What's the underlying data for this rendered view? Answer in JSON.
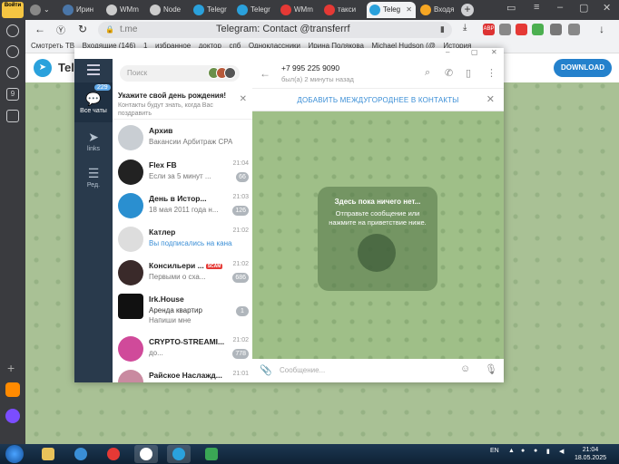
{
  "browser": {
    "profile_label": "Войти",
    "tabs": [
      {
        "label": "",
        "favicon_color": "#888888"
      },
      {
        "label": "Ирин",
        "favicon_color": "#4a76a8"
      },
      {
        "label": "WMm",
        "favicon_color": "#cccccc"
      },
      {
        "label": "Node",
        "favicon_color": "#cccccc"
      },
      {
        "label": "Telegr",
        "favicon_color": "#2aa1dc"
      },
      {
        "label": "Telegr",
        "favicon_color": "#2aa1dc"
      },
      {
        "label": "WMm",
        "favicon_color": "#e53935"
      },
      {
        "label": "такси",
        "favicon_color": "#e53935"
      },
      {
        "label": "Teleg",
        "favicon_color": "#2aa1dc",
        "active": true
      },
      {
        "label": "Входя",
        "favicon_color": "#f6a623"
      }
    ],
    "address": {
      "host": "t.me",
      "page_title": "Telegram: Contact @transferrf"
    },
    "bookmarks": [
      "Смотреть ТВ",
      "Входящие (146)",
      "1",
      "избранное",
      "доктор",
      "спб",
      "Одноклассники",
      "Ирина Полякова",
      "Michael Hudson (@",
      "История"
    ]
  },
  "tg_web": {
    "brand": "Telegram",
    "download_label": "DOWNLOAD"
  },
  "sidenav": {
    "items": [
      {
        "label": "Все чаты",
        "badge": "229",
        "icon": "chat-bubbles-icon"
      },
      {
        "label": "links",
        "icon": "send-icon"
      },
      {
        "label": "Ред.",
        "icon": "sliders-icon"
      }
    ]
  },
  "chatlist": {
    "search_placeholder": "Поиск",
    "birthday": {
      "title": "Укажите свой день рождения!",
      "subtitle": "Контакты будут знать, когда Вас поздравить"
    },
    "archive": {
      "name": "Архив",
      "preview": "Вакансии Арбитраж CPA, S..."
    },
    "chats": [
      {
        "name": "Flex FB",
        "preview": "Если за 5 минут ...",
        "time": "21:04",
        "count": "66",
        "avatar": "#222222",
        "blue": false
      },
      {
        "name": "День в Истор...",
        "preview": "18 мая 2011 года н...",
        "time": "21:03",
        "count": "126",
        "avatar": "#2a8fd0",
        "blue": false
      },
      {
        "name": "Катлер",
        "preview": "Вы подписались на канал",
        "time": "21:02",
        "count": "",
        "avatar": "#dddddd",
        "blue": true
      },
      {
        "name": "Консильери ...",
        "scam": "SCAM",
        "preview": "Первыми о сха...",
        "time": "21:02",
        "count": "686",
        "avatar": "#3a2a2a",
        "blue": false
      },
      {
        "name": "Irk.House",
        "preview": "Аренда квартир",
        "preview2": "Напиши мне",
        "time": "",
        "count": "1",
        "avatar": "#111111",
        "blue": false
      },
      {
        "name": "CRYPTO-STREAMI...",
        "preview": "до...",
        "time": "21:02",
        "count": "778",
        "avatar": "#d04a9a",
        "blue": false
      },
      {
        "name": "Райское Наслажд...",
        "preview": "",
        "time": "21:01",
        "count": "",
        "avatar": "#c98aa0",
        "blue": false
      }
    ]
  },
  "chat": {
    "phone": "+7 995 225 9090",
    "status": "был(а) 2 минуты назад",
    "add_contact": "ДОБАВИТЬ МЕЖДУГОРОДНЕЕ В КОНТАКТЫ",
    "empty_title": "Здесь пока ничего нет...",
    "empty_body": "Отправьте сообщение или нажмите на приветствие ниже.",
    "composer_placeholder": "Сообщение..."
  },
  "taskbar": {
    "lang": "EN",
    "time": "21:04",
    "date": "18.05.2025"
  }
}
